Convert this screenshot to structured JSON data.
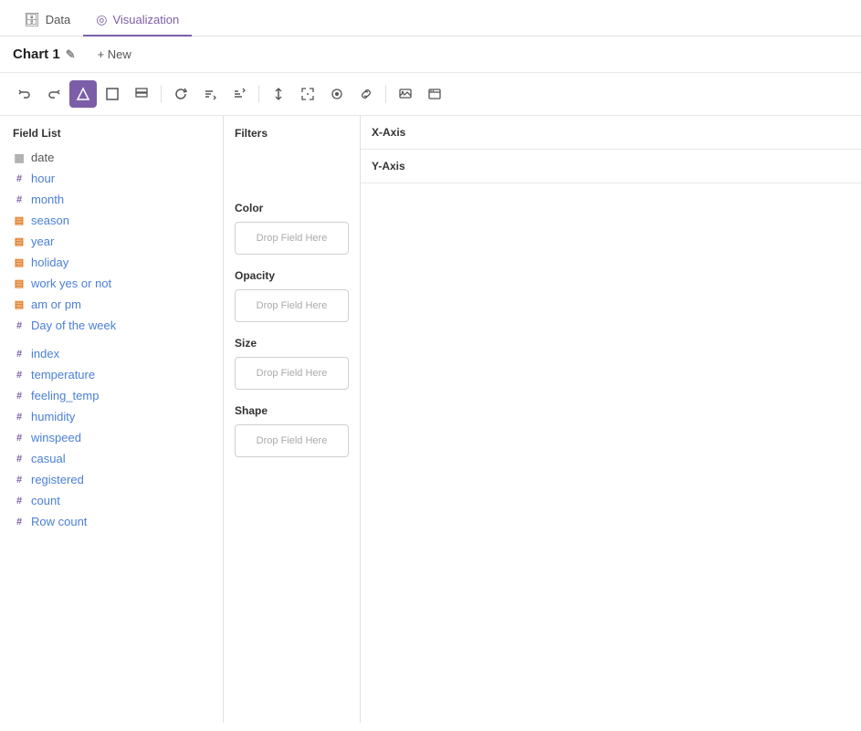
{
  "tabs": [
    {
      "id": "data",
      "label": "Data",
      "icon": "🗄",
      "active": false
    },
    {
      "id": "visualization",
      "label": "Visualization",
      "icon": "◎",
      "active": true
    }
  ],
  "chartTitle": "Chart 1",
  "newButton": "+ New",
  "toolbar": {
    "buttons": [
      {
        "id": "undo",
        "icon": "↩",
        "label": "Undo",
        "active": false
      },
      {
        "id": "redo",
        "icon": "↪",
        "label": "Redo",
        "active": false
      },
      {
        "id": "chart-type",
        "icon": "⬡",
        "label": "Chart Type",
        "active": true
      },
      {
        "id": "filter",
        "icon": "□",
        "label": "Filter",
        "active": false
      },
      {
        "id": "layers",
        "icon": "⊞",
        "label": "Layers",
        "active": false
      },
      {
        "id": "refresh",
        "icon": "↺",
        "label": "Refresh",
        "active": false
      },
      {
        "id": "sort-asc",
        "icon": "↑=",
        "label": "Sort Ascending",
        "active": false
      },
      {
        "id": "sort-desc",
        "icon": "↓=",
        "label": "Sort Descending",
        "active": false
      },
      {
        "id": "arrange",
        "icon": "⇅",
        "label": "Arrange",
        "active": false
      },
      {
        "id": "fit",
        "icon": "⤢",
        "label": "Fit",
        "active": false
      },
      {
        "id": "select",
        "icon": "⊕",
        "label": "Select",
        "active": false
      },
      {
        "id": "link",
        "icon": "⌒",
        "label": "Link",
        "active": false
      },
      {
        "id": "image",
        "icon": "🖼",
        "label": "Image Settings",
        "active": false
      },
      {
        "id": "embed",
        "icon": "⊡",
        "label": "Embed",
        "active": false
      }
    ]
  },
  "fieldList": {
    "title": "Field List",
    "fields": [
      {
        "id": "date",
        "name": "date",
        "type": "date",
        "typeIcon": "▦"
      },
      {
        "id": "hour",
        "name": "hour",
        "type": "numeric",
        "typeIcon": "#"
      },
      {
        "id": "month",
        "name": "month",
        "type": "numeric",
        "typeIcon": "#"
      },
      {
        "id": "season",
        "name": "season",
        "type": "text",
        "typeIcon": "📄"
      },
      {
        "id": "year",
        "name": "year",
        "type": "text",
        "typeIcon": "📄"
      },
      {
        "id": "holiday",
        "name": "holiday",
        "type": "text",
        "typeIcon": "📄"
      },
      {
        "id": "work yes or not",
        "name": "work yes or not",
        "type": "text",
        "typeIcon": "📄"
      },
      {
        "id": "am or pm",
        "name": "am or pm",
        "type": "text",
        "typeIcon": "📄"
      },
      {
        "id": "Day of the week",
        "name": "Day of the week",
        "type": "numeric",
        "typeIcon": "#"
      },
      {
        "id": "index",
        "name": "index",
        "type": "numeric",
        "typeIcon": "#"
      },
      {
        "id": "temperature",
        "name": "temperature",
        "type": "numeric",
        "typeIcon": "#"
      },
      {
        "id": "feeling_temp",
        "name": "feeling_temp",
        "type": "numeric",
        "typeIcon": "#"
      },
      {
        "id": "humidity",
        "name": "humidity",
        "type": "numeric",
        "typeIcon": "#"
      },
      {
        "id": "winspeed",
        "name": "winspeed",
        "type": "numeric",
        "typeIcon": "#"
      },
      {
        "id": "casual",
        "name": "casual",
        "type": "numeric",
        "typeIcon": "#"
      },
      {
        "id": "registered",
        "name": "registered",
        "type": "numeric",
        "typeIcon": "#"
      },
      {
        "id": "count",
        "name": "count",
        "type": "numeric",
        "typeIcon": "#"
      },
      {
        "id": "row-count",
        "name": "Row count",
        "type": "numeric",
        "typeIcon": "#"
      }
    ]
  },
  "filtersPanel": {
    "title": "Filters",
    "dropZoneText": ""
  },
  "colorSection": {
    "title": "Color",
    "dropZoneText": "Drop Field Here"
  },
  "opacitySection": {
    "title": "Opacity",
    "dropZoneText": "Drop Field Here"
  },
  "sizeSection": {
    "title": "Size",
    "dropZoneText": "Drop Field Here"
  },
  "shapeSection": {
    "title": "Shape",
    "dropZoneText": "Drop Field Here"
  },
  "axes": {
    "xAxis": {
      "label": "X-Axis",
      "dropZoneText": ""
    },
    "yAxis": {
      "label": "Y-Axis",
      "dropZoneText": ""
    }
  }
}
